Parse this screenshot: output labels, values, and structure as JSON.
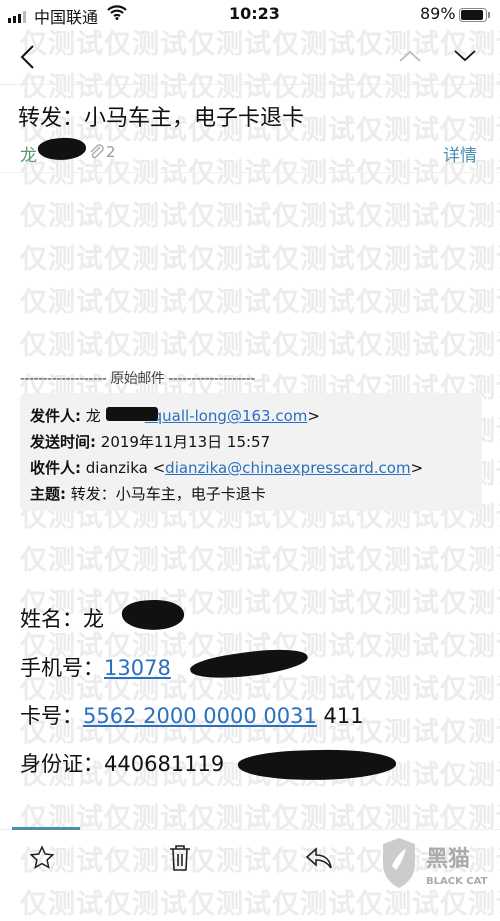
{
  "status_bar": {
    "carrier": "中国联通",
    "time": "10:23",
    "battery": "89%"
  },
  "nav": {
    "back_icon": "chevron-left",
    "prev_icon": "chevron-up",
    "next_icon": "chevron-down"
  },
  "mail": {
    "subject": "转发：小马车主，电子卡退卡",
    "sender_visible": "龙",
    "attachment_count": "2",
    "details_label": "详情",
    "original_divider": "------------------- 原始邮件 -------------------",
    "header": {
      "from_label": "发件人:",
      "from_name": "龙",
      "from_email": "squall-long@163.com",
      "from_close": ">",
      "sent_label": "发送时间:",
      "sent_value": "2019年11月13日 15:57",
      "to_label": "收件人:",
      "to_name": "dianzika <",
      "to_email": "dianzika@chinaexpresscard.com",
      "to_close": ">",
      "subject_label": "主题:",
      "subject_value": "转发：小马车主，电子卡退卡"
    },
    "body": {
      "name_label": "姓名：",
      "name_value": "龙",
      "phone_label": "手机号：",
      "phone_value": "13078",
      "card_label": "卡号：",
      "card_link": "5562 2000 0000 0031",
      "card_suffix": " 411",
      "id_label": "身份证：",
      "id_value": "440681119"
    }
  },
  "toolbar": {
    "star_icon": "star",
    "trash_icon": "trash",
    "reply_icon": "reply"
  },
  "watermark": {
    "text": "仅测试",
    "logo_cn": "黑猫",
    "logo_en": "BLACK CAT"
  },
  "colors": {
    "link": "#2a6fc0",
    "accent": "#4a8fb0",
    "sender": "#5a9a6a"
  }
}
